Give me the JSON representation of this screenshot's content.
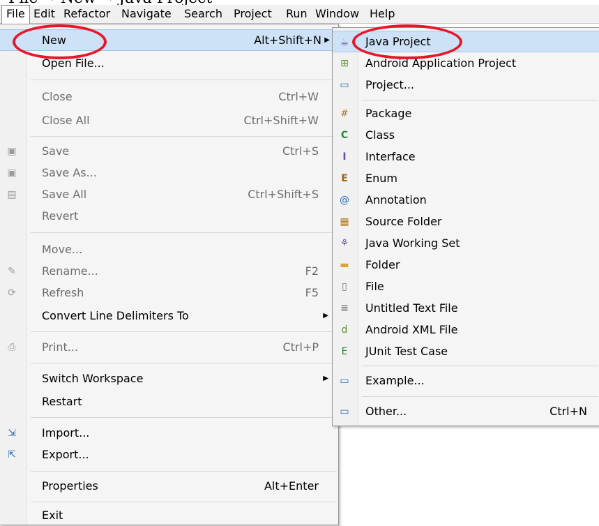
{
  "caption": "File → New → Java Project",
  "menubar": {
    "items": [
      "File",
      "Edit",
      "Refactor",
      "Navigate",
      "Search",
      "Project",
      "Run",
      "Window",
      "Help"
    ]
  },
  "file_menu": {
    "items": [
      {
        "label": "New",
        "accel": "Alt+Shift+N",
        "submenu": true,
        "enabled": true
      },
      {
        "label": "Open File...",
        "accel": "",
        "enabled": true
      },
      {
        "label": "Close",
        "accel": "Ctrl+W",
        "enabled": false
      },
      {
        "label": "Close All",
        "accel": "Ctrl+Shift+W",
        "enabled": false
      },
      {
        "label": "Save",
        "accel": "Ctrl+S",
        "enabled": false,
        "icon": "save-icon"
      },
      {
        "label": "Save As...",
        "accel": "",
        "enabled": false,
        "icon": "save-as-icon"
      },
      {
        "label": "Save All",
        "accel": "Ctrl+Shift+S",
        "enabled": false,
        "icon": "save-all-icon"
      },
      {
        "label": "Revert",
        "accel": "",
        "enabled": false
      },
      {
        "label": "Move...",
        "accel": "",
        "enabled": false
      },
      {
        "label": "Rename...",
        "accel": "F2",
        "enabled": false,
        "icon": "rename-icon"
      },
      {
        "label": "Refresh",
        "accel": "F5",
        "enabled": false,
        "icon": "refresh-icon"
      },
      {
        "label": "Convert Line Delimiters To",
        "accel": "",
        "submenu": true,
        "enabled": true
      },
      {
        "label": "Print...",
        "accel": "Ctrl+P",
        "enabled": false,
        "icon": "print-icon"
      },
      {
        "label": "Switch Workspace",
        "accel": "",
        "submenu": true,
        "enabled": true
      },
      {
        "label": "Restart",
        "accel": "",
        "enabled": true
      },
      {
        "label": "Import...",
        "accel": "",
        "enabled": true,
        "icon": "import-icon"
      },
      {
        "label": "Export...",
        "accel": "",
        "enabled": true,
        "icon": "export-icon"
      },
      {
        "label": "Properties",
        "accel": "Alt+Enter",
        "enabled": true
      },
      {
        "label": "Exit",
        "accel": "",
        "enabled": true
      }
    ]
  },
  "new_submenu": {
    "items": [
      {
        "label": "Java Project",
        "icon": "java-project-icon"
      },
      {
        "label": "Android Application Project",
        "icon": "android-project-icon"
      },
      {
        "label": "Project...",
        "icon": "project-icon"
      },
      {
        "label": "Package",
        "icon": "package-icon"
      },
      {
        "label": "Class",
        "icon": "class-icon"
      },
      {
        "label": "Interface",
        "icon": "interface-icon"
      },
      {
        "label": "Enum",
        "icon": "enum-icon"
      },
      {
        "label": "Annotation",
        "icon": "annotation-icon"
      },
      {
        "label": "Source Folder",
        "icon": "source-folder-icon"
      },
      {
        "label": "Java Working Set",
        "icon": "working-set-icon"
      },
      {
        "label": "Folder",
        "icon": "folder-icon"
      },
      {
        "label": "File",
        "icon": "file-icon"
      },
      {
        "label": "Untitled Text File",
        "icon": "text-file-icon"
      },
      {
        "label": "Android XML File",
        "icon": "android-xml-icon"
      },
      {
        "label": "JUnit Test Case",
        "icon": "junit-icon"
      },
      {
        "label": "Example...",
        "icon": "example-icon"
      },
      {
        "label": "Other...",
        "accel": "Ctrl+N",
        "icon": "other-icon"
      }
    ]
  },
  "colors": {
    "highlight": "#cde2f6",
    "annotation_circle": "#e8162a",
    "disabled_text": "#6d6d6d"
  }
}
